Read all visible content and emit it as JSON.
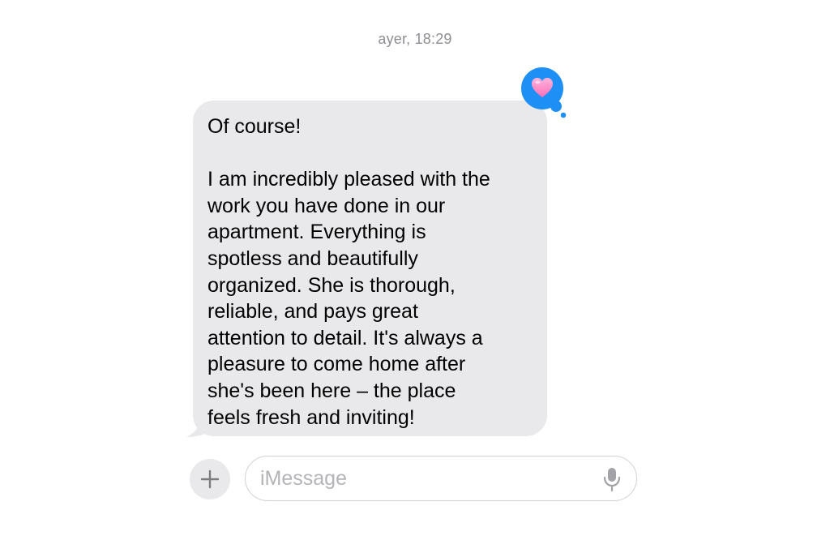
{
  "conversation": {
    "timestamp": "ayer, 18:29",
    "message": {
      "text": "Of course!\n\nI am incredibly pleased with the\nwork you have done in our\napartment. Everything is\nspotless and beautifully\norganized. She is thorough,\nreliable, and pays great\nattention to detail. It's always a\npleasure to come home after\nshe's been here – the place\nfeels fresh and inviting!",
      "bubble_color": "#e9e9eb",
      "tapback": {
        "icon": "heart-icon",
        "badge_color": "#1e90f5",
        "heart_color": "#ff8fc8"
      }
    }
  },
  "composer": {
    "plus_icon": "plus-icon",
    "placeholder": "iMessage",
    "value": "",
    "mic_icon": "microphone-icon"
  }
}
